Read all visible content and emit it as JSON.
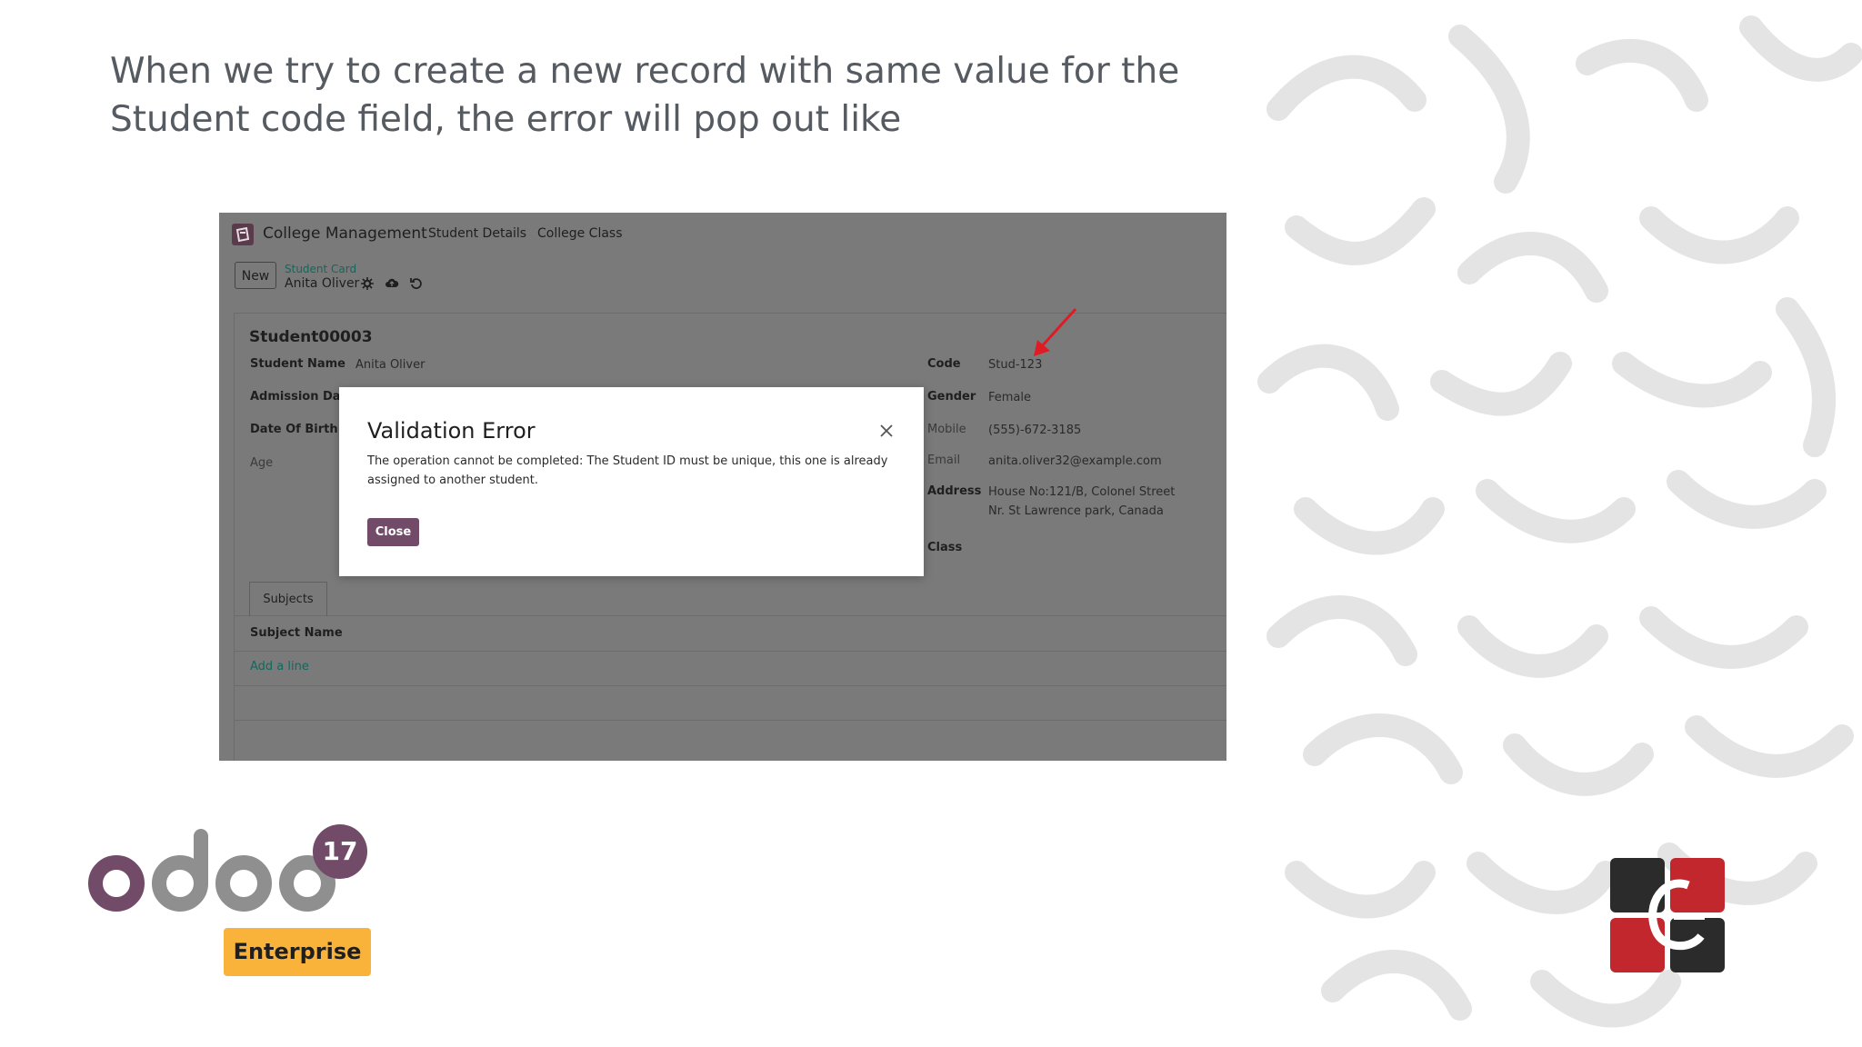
{
  "slide": {
    "headline": "When we try to create a new record with same value for the Student code field, the error will pop out like"
  },
  "app": {
    "name": "College Management",
    "menu": [
      "Student Details",
      "College Class"
    ],
    "new_label": "New",
    "breadcrumb": "Student Card",
    "record_name": "Anita Oliver"
  },
  "form": {
    "title": "Student00003",
    "left_fields": [
      {
        "label": "Student Name",
        "value": "Anita Oliver"
      },
      {
        "label": "Admission Date",
        "value": ""
      },
      {
        "label": "Date Of Birth",
        "value": ""
      },
      {
        "label": "Age",
        "value": ""
      }
    ],
    "right_fields": [
      {
        "label": "Code",
        "value": "Stud-123"
      },
      {
        "label": "Gender",
        "value": "Female"
      },
      {
        "label": "Mobile",
        "value": "(555)-672-3185"
      },
      {
        "label": "Email",
        "value": "anita.oliver32@example.com"
      },
      {
        "label": "Address",
        "value": "House No:121/B, Colonel Street",
        "value2": "Nr. St Lawrence park, Canada"
      },
      {
        "label": "Class",
        "value": ""
      }
    ],
    "tab_label": "Subjects",
    "column_header": "Subject Name",
    "add_line_label": "Add a line"
  },
  "dialog": {
    "title": "Validation Error",
    "message": "The operation cannot be completed: The Student ID must be unique, this one is already assigned to another student.",
    "close_label": "Close"
  },
  "branding": {
    "product": "odoo",
    "version": "17",
    "edition": "Enterprise"
  },
  "colors": {
    "primary": "#714b67",
    "badge": "#f9b23a",
    "link": "#14675d",
    "overlay": "#7a7a7a",
    "arrow": "#e01b24"
  }
}
